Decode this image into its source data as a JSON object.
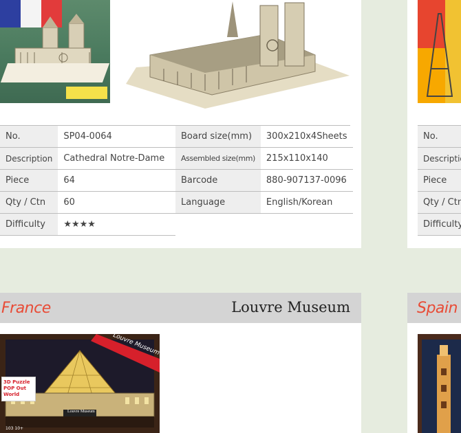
{
  "product": {
    "specs_left": [
      {
        "key": "No.",
        "value": "SP04-0064"
      },
      {
        "key": "Description",
        "value": "Cathedral Notre-Dame"
      },
      {
        "key": "Piece",
        "value": "64"
      },
      {
        "key": "Qty / Ctn",
        "value": "60"
      },
      {
        "key": "Difficulty",
        "value": "★★★★"
      }
    ],
    "specs_right": [
      {
        "key": "Board size(mm)",
        "value": "300x210x4Sheets"
      },
      {
        "key": "Assembled size(mm)",
        "value": "215x110x140"
      },
      {
        "key": "Barcode",
        "value": "880-907137-0096"
      },
      {
        "key": "Language",
        "value": "English/Korean"
      }
    ]
  },
  "next_product": {
    "specs_keys": [
      "No.",
      "Description",
      "Piece",
      "Qty / Ctn",
      "Difficulty"
    ]
  },
  "section_louvre": {
    "country": "France",
    "landmark": "Louvre Museum",
    "box_ribbon": "Louvre Museum",
    "box_brand": "3D Puzzle POP Out World",
    "box_name": "Louvre Museum",
    "box_piece": "103",
    "box_age": "10+"
  },
  "section_next": {
    "country": "Spain"
  },
  "colors": {
    "page_bg": "#e6ecdf",
    "header_bg": "#d4d4d4",
    "country_text": "#e84c37",
    "key_cell_bg": "#eeeeee"
  }
}
